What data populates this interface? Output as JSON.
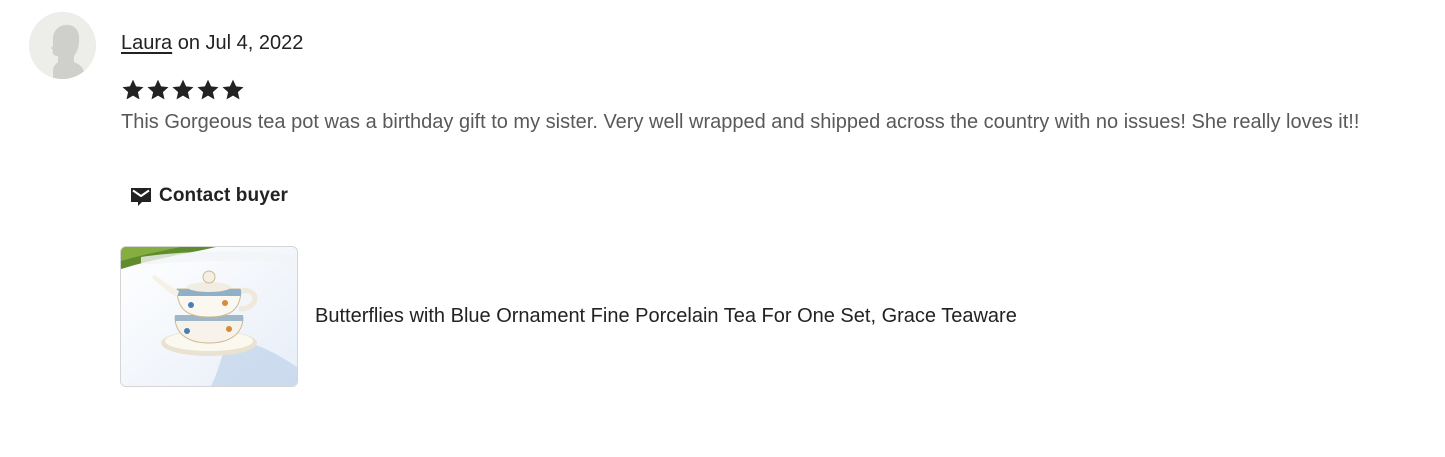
{
  "review": {
    "reviewer_name": "Laura",
    "date_text": " on Jul 4, 2022",
    "rating": 5,
    "rating_max": 5,
    "text": "This Gorgeous tea pot was a birthday gift to my sister. Very well wrapped and shipped across the country with no issues! She really loves it!!",
    "avatar_icon": "default-avatar-icon",
    "star_icon": "star-icon",
    "star_color": "#222222"
  },
  "contact": {
    "label": "Contact buyer",
    "icon": "mail-icon"
  },
  "listing": {
    "title": "Butterflies with Blue Ornament Fine Porcelain Tea For One Set, Grace Teaware",
    "image_icon": "teapot-product-image"
  }
}
